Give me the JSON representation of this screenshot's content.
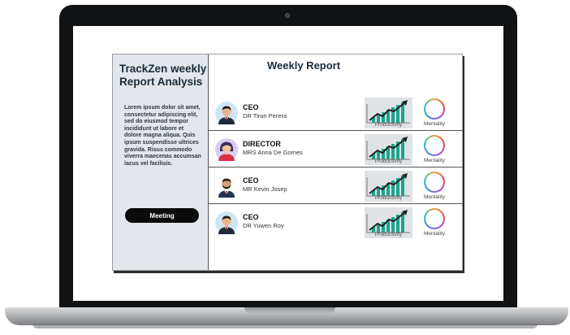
{
  "sidebar": {
    "title_line1": "TrackZen weekly",
    "title_line2": "Report Analysis",
    "body": "Lorem ipsum dolor sit amet, consectetur adipiscing elit, sed do eiusmod tempor incididunt ut labore et dolore magna aliqua. Quis ipsum suspendisse ultrices gravida. Risus commodo viverra maecenas accumsan lacus vel facilisis.",
    "meeting_label": "Meeting"
  },
  "main": {
    "title": "Weekly Report",
    "rows": [
      {
        "role": "CEO",
        "name": "DR Tiron Perera",
        "productivity_label": "Productivity",
        "mentality_label": "Mentality"
      },
      {
        "role": "DIRECTOR",
        "name": "MRS Anna De Gomes",
        "productivity_label": "Productivity",
        "mentality_label": "Mentality"
      },
      {
        "role": "CEO",
        "name": "MR Kevin Josep",
        "productivity_label": "Productivity",
        "mentality_label": "Mentality"
      },
      {
        "role": "CEO",
        "name": "DR Yuwen Roy",
        "productivity_label": "Productivity",
        "mentality_label": "Mentality"
      }
    ]
  },
  "colors": {
    "accent_teal": "#1aa68e",
    "sidebar_bg": "#e3e7eb",
    "button_bg": "#0b0b0b"
  }
}
